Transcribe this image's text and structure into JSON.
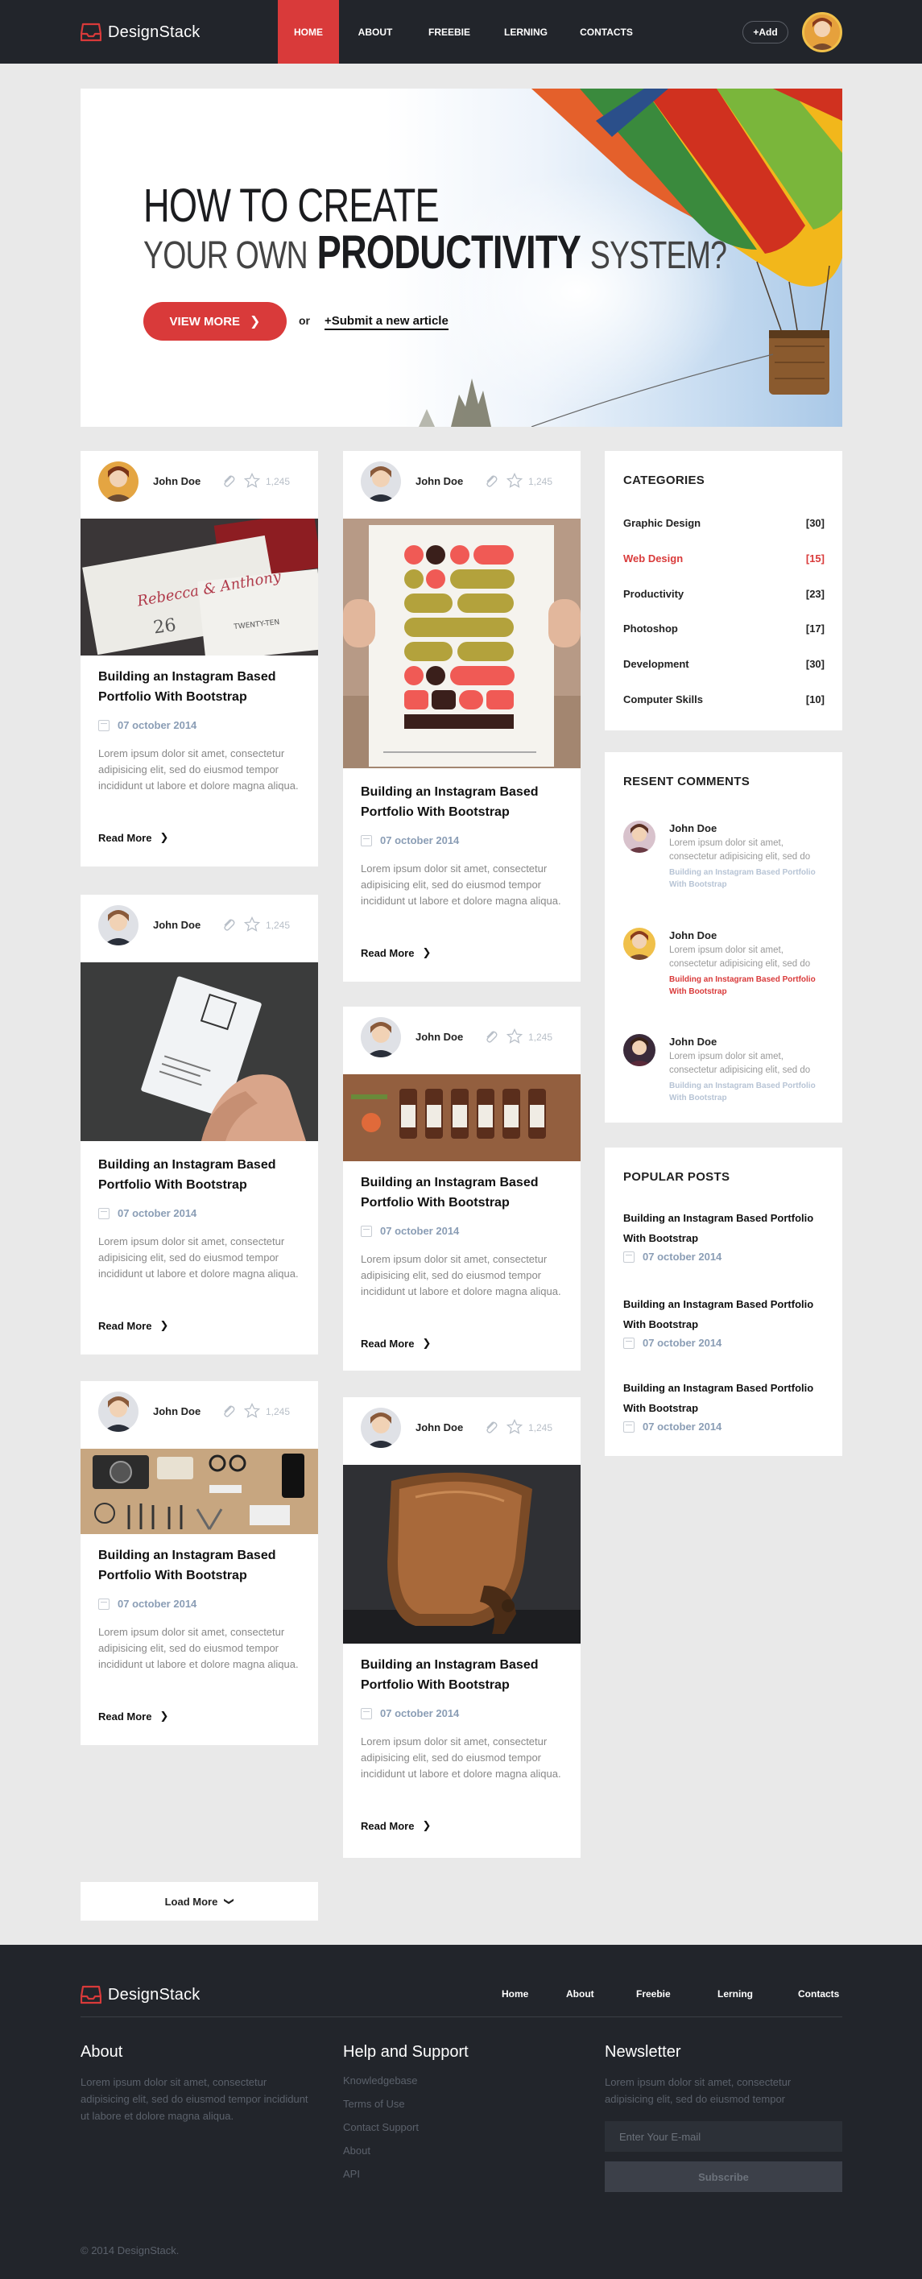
{
  "header": {
    "brand": "DesignStack",
    "nav": [
      "HOME",
      "ABOUT",
      "FREEBIE",
      "LERNING",
      "CONTACTS"
    ],
    "add_label": "+Add"
  },
  "hero": {
    "line1": "HOW TO CREATE",
    "line2_a": "YOUR OWN",
    "line2_b": "PRODUCTIVITY",
    "line2_c": "SYSTEM?",
    "view_more": "VIEW MORE",
    "or": "or",
    "submit": "+Submit a new article"
  },
  "post": {
    "author": "John Doe",
    "count": "1,245",
    "title": "Building an Instagram Based Portfolio With Bootstrap",
    "date": "07 october 2014",
    "text": "Lorem ipsum dolor sit amet, consectetur adipisicing elit, sed do eiusmod tempor incididunt ut labore et dolore magna aliqua.",
    "read_more": "Read More"
  },
  "categories": {
    "title": "CATEGORIES",
    "items": [
      {
        "name": "Graphic Design",
        "count": "[30]"
      },
      {
        "name": "Web Design",
        "count": "[15]"
      },
      {
        "name": "Productivity",
        "count": "[23]"
      },
      {
        "name": "Photoshop",
        "count": "[17]"
      },
      {
        "name": "Development",
        "count": "[30]"
      },
      {
        "name": "Computer Skills",
        "count": "[10]"
      }
    ]
  },
  "comments": {
    "title": "RESENT COMMENTS",
    "items": [
      {
        "name": "John Doe",
        "text": "Lorem ipsum dolor sit amet, consectetur adipisicing elit, sed do",
        "link": "Building an Instagram Based Portfolio With Bootstrap"
      },
      {
        "name": "John Doe",
        "text": "Lorem ipsum dolor sit amet, consectetur adipisicing elit, sed do",
        "link": "Building an Instagram Based Portfolio With Bootstrap"
      },
      {
        "name": "John Doe",
        "text": "Lorem ipsum dolor sit amet, consectetur adipisicing elit, sed do",
        "link": "Building an Instagram Based Portfolio With Bootstrap"
      }
    ]
  },
  "popular": {
    "title": "POPULAR POSTS",
    "items": [
      {
        "title": "Building an Instagram Based Portfolio With Bootstrap",
        "date": "07 october 2014"
      },
      {
        "title": "Building an Instagram Based Portfolio With Bootstrap",
        "date": "07 october 2014"
      },
      {
        "title": "Building an Instagram Based Portfolio With Bootstrap",
        "date": "07 october 2014"
      }
    ]
  },
  "load_more": "Load More",
  "footer": {
    "brand": "DesignStack",
    "nav": [
      "Home",
      "About",
      "Freebie",
      "Lerning",
      "Contacts"
    ],
    "about_title": "About",
    "about_text": "Lorem ipsum dolor sit amet, consectetur adipisicing elit, sed do eiusmod tempor incididunt ut labore et dolore magna aliqua.",
    "help_title": "Help and Support",
    "help_links": [
      "Knowledgebase",
      "Terms of Use",
      "Contact Support",
      "About",
      "API"
    ],
    "news_title": "Newsletter",
    "news_text": "Lorem ipsum dolor sit amet, consectetur adipisicing elit, sed do eiusmod tempor",
    "email_placeholder": "Enter Your E-mail",
    "subscribe": "Subscribe",
    "copyright": "© 2014 DesignStack."
  },
  "colors": {
    "accent": "#d93a3a",
    "dark": "#22252b",
    "date": "#8a9db5"
  }
}
